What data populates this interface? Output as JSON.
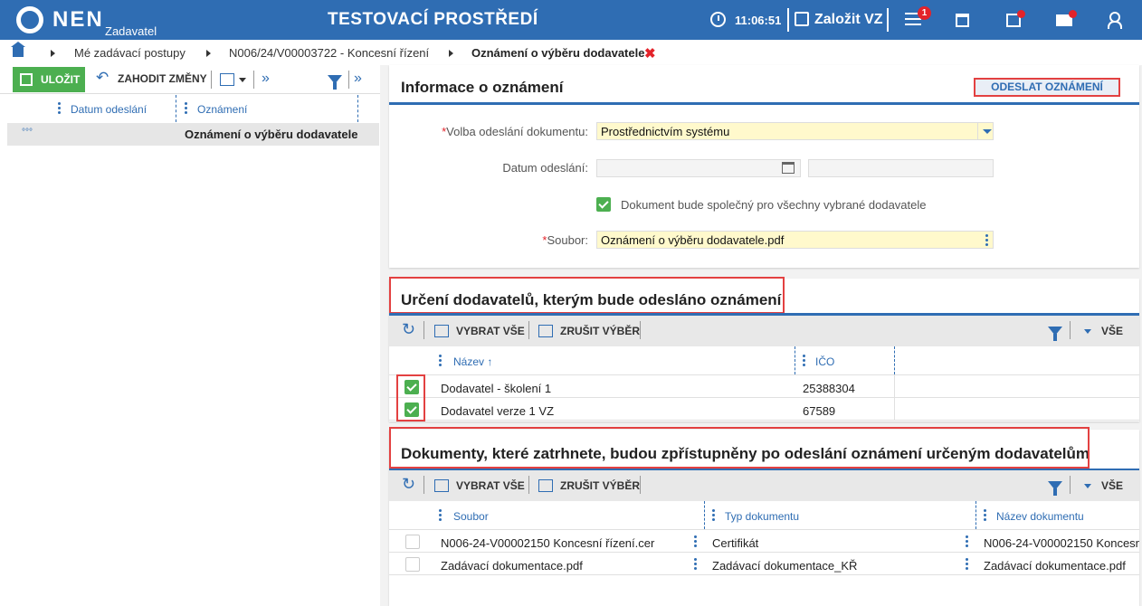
{
  "topbar": {
    "logo": "NEN",
    "logo_sub": "Zadavatel",
    "environment": "TESTOVACÍ PROSTŘEDÍ",
    "clock": "11:06:51",
    "create_label": "Založit VZ",
    "notif_count": "1",
    "icons": [
      "menu-icon",
      "calendar-icon",
      "inbox-icon",
      "mail-icon",
      "user-icon"
    ]
  },
  "breadcrumb": {
    "items": [
      "Mé zadávací postupy",
      "N006/24/V00003722 - Koncesní řízení",
      "Oznámení o výběru dodavatele"
    ],
    "close": "✖"
  },
  "left": {
    "save": "ULOŽIT",
    "discard": "ZAHODIT ZMĚNY",
    "columns": [
      "Datum odeslání",
      "Oznámení"
    ],
    "row": {
      "dots": "°°°",
      "value": "Oznámení o výběru dodavatele"
    }
  },
  "info": {
    "title": "Informace o oznámení",
    "send_button": "ODESLAT OZNÁMENÍ",
    "doc_send_label": "Volba odeslání dokumentu:",
    "doc_send_value": "Prostřednictvím systému",
    "date_label": "Datum odeslání:",
    "date_value": "",
    "time_value": "",
    "common_label": "Dokument bude společný pro všechny vybrané dodavatele",
    "file_label": "Soubor:",
    "file_value": "Oznámení o výběru dodavatele.pdf"
  },
  "suppliers": {
    "title": "Určení dodavatelů, kterým bude odesláno oznámení",
    "select_all": "VYBRAT VŠE",
    "cancel_select": "ZRUŠIT VÝBĚR",
    "filter": "VŠE",
    "columns": [
      "Název ↑",
      "IČO"
    ],
    "rows": [
      {
        "name": "Dodavatel - školení 1",
        "ico": "25388304",
        "checked": true
      },
      {
        "name": "Dodavatel verze 1 VZ",
        "ico": "67589",
        "checked": true
      }
    ]
  },
  "documents": {
    "title": "Dokumenty, které zatrhnete, budou zpřístupněny po odeslání oznámení určeným dodavatelům",
    "select_all": "VYBRAT VŠE",
    "cancel_select": "ZRUŠIT VÝBĚR",
    "filter": "VŠE",
    "columns": [
      "Soubor",
      "Typ dokumentu",
      "Název dokumentu"
    ],
    "rows": [
      {
        "file": "N006-24-V00002150 Koncesní řízení.cer",
        "type": "Certifikát",
        "name": "N006-24-V00002150 Koncesn",
        "checked": false
      },
      {
        "file": "Zadávací dokumentace.pdf",
        "type": "Zadávací dokumentace_KŘ",
        "name": "Zadávací dokumentace.pdf",
        "checked": false
      }
    ]
  }
}
